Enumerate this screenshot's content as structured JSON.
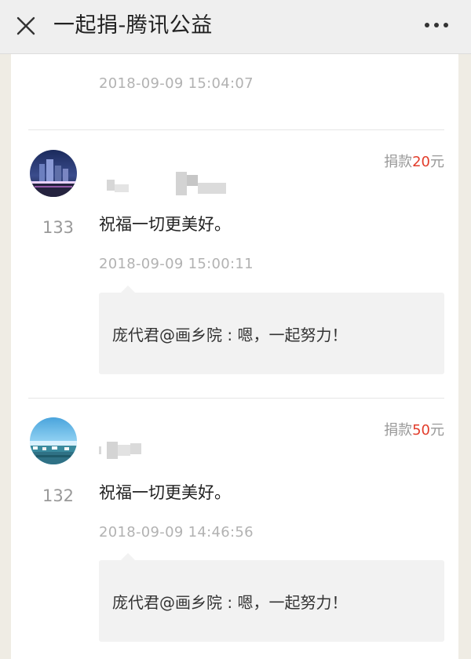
{
  "topbar": {
    "title": "一起捐-腾讯公益",
    "close_icon": "close-icon",
    "more_icon": "more-icon"
  },
  "colors": {
    "amount": "#e23d2b",
    "muted": "#999999",
    "background": "#efece4"
  },
  "top_partial": {
    "time": "2018-09-09 15:04:07"
  },
  "entries": [
    {
      "rank": "133",
      "donation_prefix": "捐款",
      "amount": "20",
      "donation_suffix": "元",
      "message": "祝福一切更美好。",
      "time": "2018-09-09 15:00:11",
      "reply": "庞代君@画乡院 : 嗯，一起努力！"
    },
    {
      "rank": "132",
      "donation_prefix": "捐款",
      "amount": "50",
      "donation_suffix": "元",
      "message": "祝福一切更美好。",
      "time": "2018-09-09 14:46:56",
      "reply": "庞代君@画乡院 : 嗯，一起努力！"
    }
  ]
}
